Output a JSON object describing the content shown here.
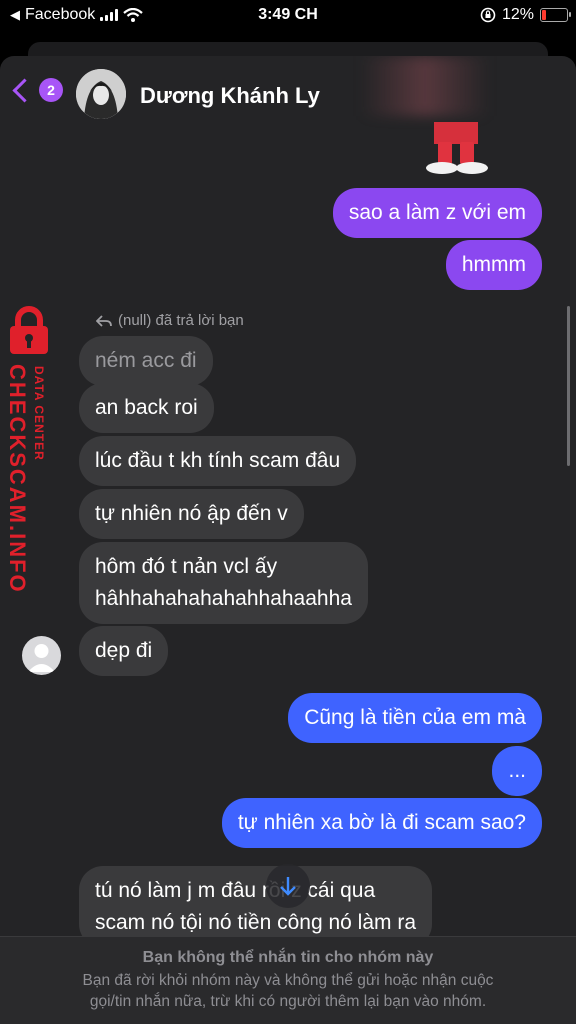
{
  "status_bar": {
    "back_app": "Facebook",
    "time": "3:49 CH",
    "battery": "12%",
    "battery_color": "#ff3b30"
  },
  "header": {
    "back_badge": "2",
    "contact_name": "Dương Khánh Ly",
    "accent_color": "#a855f7"
  },
  "messages": {
    "out1": "sao a làm z với em",
    "out2": "hmmm",
    "reply_note": "(null) đã trả lời bạn",
    "in0": "ném acc đi",
    "in1": "an back roi",
    "in2": "lúc đầu t kh tính scam đâu",
    "in3": "tự nhiên nó ập đến v",
    "in4_line1": "hôm đó t nản vcl ấy",
    "in4_line2": "hâhhahahahahahhahaahha",
    "in5": "dẹp đi",
    "out3": "Cũng là tiền của em mà",
    "out4": "...",
    "out5": "tự nhiên xa bờ là đi scam sao?",
    "in6_line1": "tú nó làm j m đâu rồi z cái qua",
    "in6_line2": "scam nó tội nó tiền công nó làm ra"
  },
  "colors": {
    "purple_bubble": "#8b48f0",
    "blue_bubble": "#3f63ff",
    "incoming_bubble": "#3a3a3c"
  },
  "watermark": {
    "line1": "DATA CENTER",
    "line2": "CHECKSCAM.INFO"
  },
  "footer": {
    "title": "Bạn không thể nhắn tin cho nhóm này",
    "desc_line1": "Bạn đã rời khỏi nhóm này và không thể gửi hoặc nhận cuộc",
    "desc_line2": "gọi/tin nhắn nữa, trừ khi có người thêm lại bạn vào nhóm."
  },
  "icons": [
    "back-chevron-icon",
    "reply-arrow-icon",
    "scroll-down-arrow-icon",
    "lock-icon",
    "wifi-icon",
    "signal-icon",
    "battery-icon",
    "orientation-lock-icon"
  ]
}
